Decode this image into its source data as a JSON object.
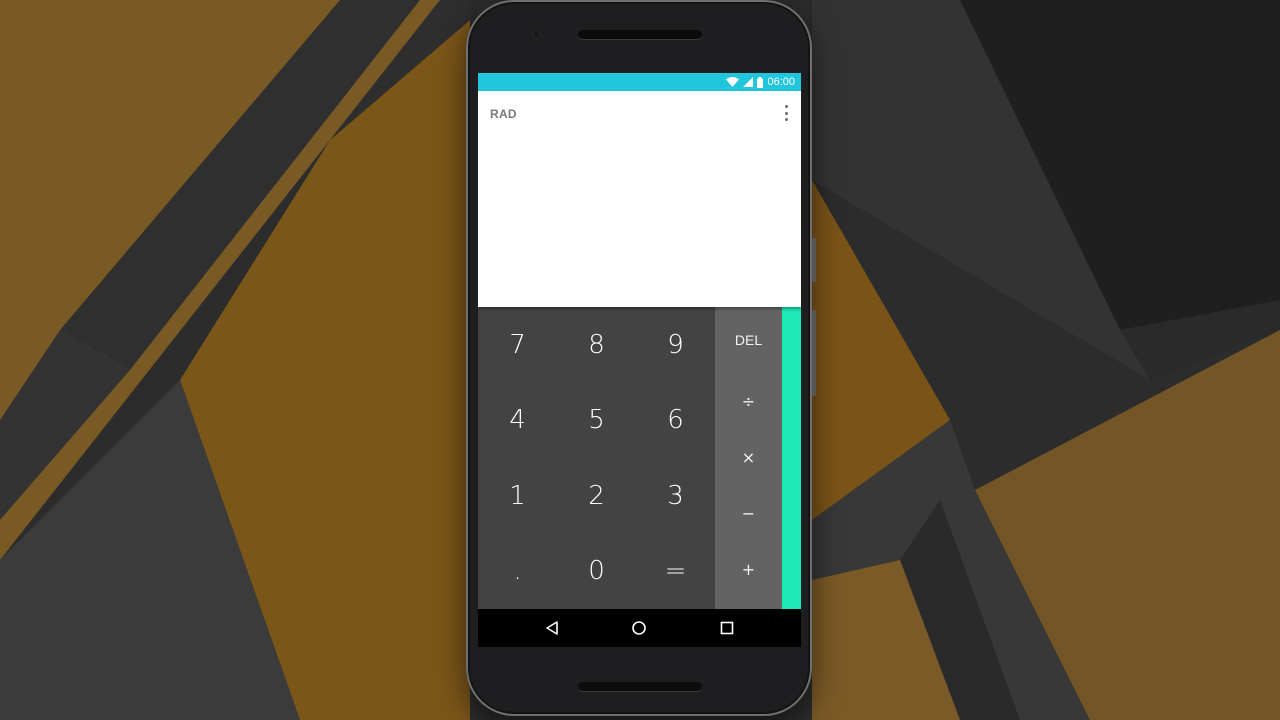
{
  "status_bar": {
    "time": "06:00",
    "icons": [
      "wifi-icon",
      "signal-icon",
      "battery-icon"
    ],
    "color": "#21c5dc"
  },
  "display": {
    "mode_label": "RAD",
    "menu_icon": "overflow-menu-icon"
  },
  "keypad": {
    "keys": [
      "7",
      "8",
      "9",
      "4",
      "5",
      "6",
      "1",
      "2",
      "3",
      ".",
      "0",
      "="
    ]
  },
  "operators": {
    "del": "DEL",
    "divide": "÷",
    "multiply": "×",
    "subtract": "−",
    "add": "+"
  },
  "accent_colors": {
    "drawer": "#1de9b6",
    "keypad_bg": "#434343",
    "operator_bg": "#636363"
  },
  "nav_bar": {
    "icons": [
      "back-icon",
      "home-icon",
      "recents-icon"
    ]
  }
}
